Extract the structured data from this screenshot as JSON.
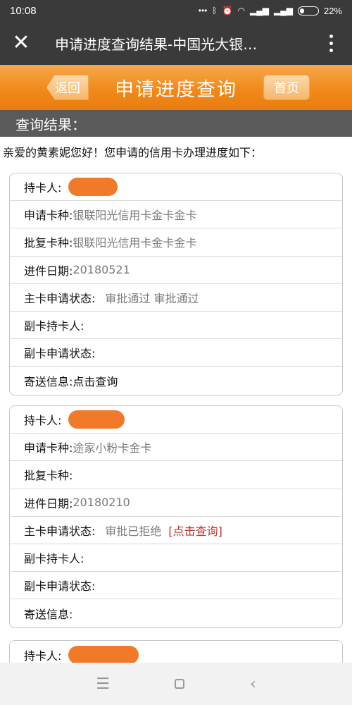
{
  "status_bar": {
    "time": "10:08",
    "icons": [
      "dots-icon",
      "bluetooth-icon",
      "alarm-icon",
      "wifi-icon",
      "signal-icon",
      "signal-icon",
      "battery-icon"
    ],
    "battery": "22%",
    "battery_level": 0.22
  },
  "title_bar": {
    "close_icon": "close-icon",
    "title": "申请进度查询结果-中国光大银…",
    "more_icon": "more-vertical-icon"
  },
  "page_header": {
    "back_label": "返回",
    "title": "申请进度查询",
    "home_label": "首页",
    "accent": "#f08a1a"
  },
  "section_title": "查询结果：",
  "greeting": "亲爱的黄素妮您好！您申请的信用卡办理进度如下：",
  "cards": [
    {
      "holder_label": "持卡人:",
      "apply_label": "申请卡种:",
      "apply_value": "银联阳光信用卡金卡金卡",
      "approve_label": "批复卡种:",
      "approve_value": "银联阳光信用卡金卡金卡",
      "date_label": "进件日期:",
      "date_value": "20180521",
      "status_label": "主卡申请状态:",
      "status_value": "审批通过  审批通过",
      "sub_holder_label": "副卡持卡人:",
      "sub_status_label": "副卡申请状态:",
      "mail_label": "寄送信息:",
      "mail_link": "点击查询"
    },
    {
      "holder_label": "持卡人:",
      "apply_label": "申请卡种:",
      "apply_value": "途家小粉卡金卡",
      "approve_label": "批复卡种:",
      "date_label": "进件日期:",
      "date_value": "20180210",
      "status_label": "主卡申请状态:",
      "status_value": "审批已拒绝",
      "status_link": "[点击查询]",
      "sub_holder_label": "副卡持卡人:",
      "sub_status_label": "副卡申请状态:",
      "mail_label": "寄送信息:"
    },
    {
      "holder_label": "持卡人:"
    }
  ],
  "nav_bar": {
    "menu_icon": "menu-icon",
    "home_icon": "home-square-icon",
    "back_icon": "back-chevron-icon",
    "menu_glyph": "☰",
    "back_glyph": "‹"
  }
}
